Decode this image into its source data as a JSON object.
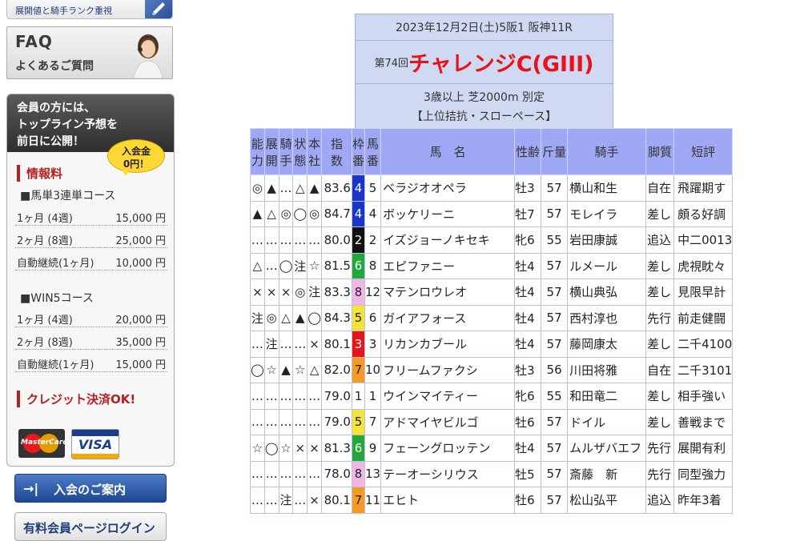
{
  "sidebar": {
    "top_banner": "展開値と騎手ランク重視",
    "faq": {
      "title": "FAQ",
      "subtitle": "よくあるご質問"
    },
    "member": {
      "heading_lines": [
        "会員の方には、",
        "トップライン予想を",
        "前日に公開！"
      ],
      "badge_lines": [
        "入会金",
        "0円！"
      ],
      "info_title": "情報料",
      "courses": [
        {
          "name": "■馬単3連単コース",
          "rows": [
            {
              "label": "1ヶ月 (4週)",
              "price": "15,000 円"
            },
            {
              "label": "2ヶ月 (8週)",
              "price": "25,000 円"
            },
            {
              "label": "自動継続(1ヶ月)",
              "price": "10,000 円"
            }
          ]
        },
        {
          "name": "■WIN5コース",
          "rows": [
            {
              "label": "1ヶ月 (4週)",
              "price": "20,000 円"
            },
            {
              "label": "2ヶ月 (8週)",
              "price": "35,000 円"
            },
            {
              "label": "自動継続(1ヶ月)",
              "price": "15,000 円"
            }
          ]
        }
      ],
      "credit": "クレジット決済OK!",
      "cards": [
        "MasterCard",
        "VISA"
      ]
    },
    "join_button": "入会のご案内",
    "login_button": "有料会員ページログイン"
  },
  "race": {
    "date_line": "2023年12月2日(土)5阪1 阪神11R",
    "number": "第74回",
    "name": "チャレンジC(GIII)",
    "conditions": "3歳以上 芝2000m 別定",
    "pace": "【上位拮抗・スローペース】"
  },
  "table": {
    "headers": [
      {
        "top": "能",
        "bottom": "力"
      },
      {
        "top": "展",
        "bottom": "開"
      },
      {
        "top": "騎",
        "bottom": "手"
      },
      {
        "top": "状",
        "bottom": "態"
      },
      {
        "top": "本",
        "bottom": "社"
      },
      {
        "top": "指",
        "bottom": "数"
      },
      {
        "top": "枠",
        "bottom": "番"
      },
      {
        "top": "馬",
        "bottom": "番"
      },
      {
        "top": "馬　名",
        "bottom": ""
      },
      {
        "top": "性齢",
        "bottom": ""
      },
      {
        "top": "斤量",
        "bottom": ""
      },
      {
        "top": "騎手",
        "bottom": ""
      },
      {
        "top": "脚質",
        "bottom": ""
      },
      {
        "top": "短評",
        "bottom": ""
      }
    ],
    "frame_colors": {
      "1": {
        "bg": "#ffffff",
        "fg": "#222222"
      },
      "2": {
        "bg": "#111111",
        "fg": "#ffffff"
      },
      "3": {
        "bg": "#e8141c",
        "fg": "#ffffff"
      },
      "4": {
        "bg": "#1a36c8",
        "fg": "#ffffff"
      },
      "5": {
        "bg": "#f6e33a",
        "fg": "#222222"
      },
      "6": {
        "bg": "#22a83a",
        "fg": "#ffffff"
      },
      "7": {
        "bg": "#f59a23",
        "fg": "#222222"
      },
      "8": {
        "bg": "#f2b6e6",
        "fg": "#222222"
      }
    },
    "rows": [
      {
        "m": [
          "◎",
          "▲",
          "…",
          "△",
          "▲"
        ],
        "idx": "83.6",
        "frame": "4",
        "num": "5",
        "name": "ベラジオオペラ",
        "sex": "牡3",
        "wt": "57",
        "jockey": "横山和生",
        "leg": "自在",
        "comment": "飛躍期す"
      },
      {
        "m": [
          "▲",
          "△",
          "◎",
          "◯",
          "◎"
        ],
        "idx": "84.7",
        "frame": "4",
        "num": "4",
        "name": "ボッケリーニ",
        "sex": "牡7",
        "wt": "57",
        "jockey": "モレイラ",
        "leg": "差し",
        "comment": "頗る好調"
      },
      {
        "m": [
          "…",
          "…",
          "…",
          "…",
          "…"
        ],
        "idx": "80.0",
        "frame": "2",
        "num": "2",
        "name": "イズジョーノキセキ",
        "sex": "牝6",
        "wt": "55",
        "jockey": "岩田康誠",
        "leg": "追込",
        "comment": "中二0013"
      },
      {
        "m": [
          "△",
          "…",
          "◯",
          "注",
          "☆"
        ],
        "idx": "81.5",
        "frame": "6",
        "num": "8",
        "name": "エピファニー",
        "sex": "牡4",
        "wt": "57",
        "jockey": "ルメール",
        "leg": "差し",
        "comment": "虎視眈々"
      },
      {
        "m": [
          "×",
          "×",
          "×",
          "◎",
          "注"
        ],
        "idx": "83.3",
        "frame": "8",
        "num": "12",
        "name": "マテンロウレオ",
        "sex": "牡4",
        "wt": "57",
        "jockey": "横山典弘",
        "leg": "差し",
        "comment": "見限早計"
      },
      {
        "m": [
          "注",
          "◎",
          "△",
          "▲",
          "◯"
        ],
        "idx": "84.3",
        "frame": "5",
        "num": "6",
        "name": "ガイアフォース",
        "sex": "牡4",
        "wt": "57",
        "jockey": "西村淳也",
        "leg": "先行",
        "comment": "前走健闘"
      },
      {
        "m": [
          "…",
          "注",
          "…",
          "…",
          "×"
        ],
        "idx": "80.1",
        "frame": "3",
        "num": "3",
        "name": "リカンカブール",
        "sex": "牡4",
        "wt": "57",
        "jockey": "藤岡康太",
        "leg": "差し",
        "comment": "二千4100"
      },
      {
        "m": [
          "◯",
          "☆",
          "▲",
          "☆",
          "△"
        ],
        "idx": "82.0",
        "frame": "7",
        "num": "10",
        "name": "フリームファクシ",
        "sex": "牡3",
        "wt": "56",
        "jockey": "川田将雅",
        "leg": "自在",
        "comment": "二千3101"
      },
      {
        "m": [
          "…",
          "…",
          "…",
          "…",
          "…"
        ],
        "idx": "79.0",
        "frame": "1",
        "num": "1",
        "name": "ウインマイティー",
        "sex": "牝6",
        "wt": "55",
        "jockey": "和田竜二",
        "leg": "差し",
        "comment": "相手強い"
      },
      {
        "m": [
          "…",
          "…",
          "…",
          "…",
          "…"
        ],
        "idx": "79.0",
        "frame": "5",
        "num": "7",
        "name": "アドマイヤビルゴ",
        "sex": "牡6",
        "wt": "57",
        "jockey": "ドイル",
        "leg": "差し",
        "comment": "善戦まで"
      },
      {
        "m": [
          "☆",
          "◯",
          "☆",
          "×",
          "×"
        ],
        "idx": "81.3",
        "frame": "6",
        "num": "9",
        "name": "フェーングロッテン",
        "sex": "牡4",
        "wt": "57",
        "jockey": "ムルザバエフ",
        "leg": "先行",
        "comment": "展開有利"
      },
      {
        "m": [
          "…",
          "…",
          "…",
          "…",
          "…"
        ],
        "idx": "78.0",
        "frame": "8",
        "num": "13",
        "name": "テーオーシリウス",
        "sex": "牡5",
        "wt": "57",
        "jockey": "斎藤　新",
        "leg": "先行",
        "comment": "同型強力"
      },
      {
        "m": [
          "…",
          "…",
          "注",
          "…",
          "×"
        ],
        "idx": "80.1",
        "frame": "7",
        "num": "11",
        "name": "エヒト",
        "sex": "牡6",
        "wt": "57",
        "jockey": "松山弘平",
        "leg": "追込",
        "comment": "昨年3着"
      }
    ]
  }
}
